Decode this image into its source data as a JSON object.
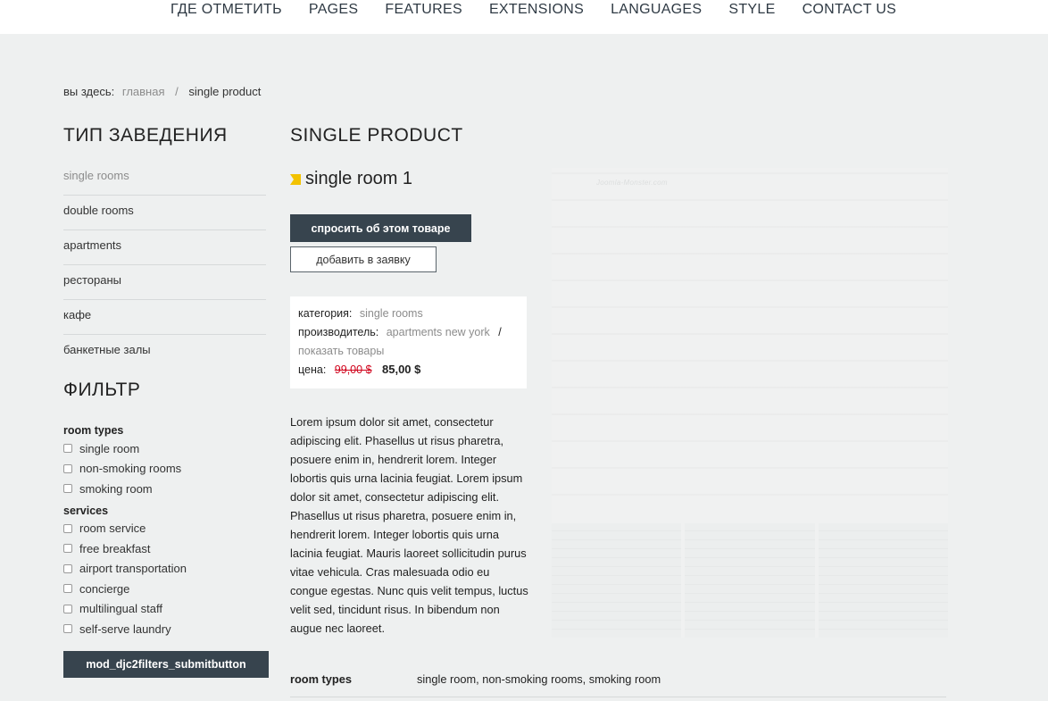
{
  "nav": {
    "items": [
      "ГДЕ ОТМЕТИТЬ",
      "PAGES",
      "FEATURES",
      "EXTENSIONS",
      "LANGUAGES",
      "STYLE",
      "CONTACT US"
    ]
  },
  "breadcrumb": {
    "label": "вы здесь:",
    "home": "главная",
    "separator": "/",
    "current": "single product"
  },
  "sidebar": {
    "category_title": "ТИП ЗАВЕДЕНИЯ",
    "items": [
      {
        "label": "single rooms",
        "active": true
      },
      {
        "label": "double rooms",
        "active": false
      },
      {
        "label": "apartments",
        "active": false
      },
      {
        "label": "рестораны",
        "active": false
      },
      {
        "label": "кафе",
        "active": false
      },
      {
        "label": "банкетные залы",
        "active": false
      }
    ],
    "filter_title": "ФИЛЬТР",
    "filter_groups": [
      {
        "title": "room types",
        "options": [
          "single room",
          "non-smoking rooms",
          "smoking room"
        ]
      },
      {
        "title": "services",
        "options": [
          "room service",
          "free breakfast",
          "airport transportation",
          "concierge",
          "multilingual staff",
          "self-serve laundry"
        ]
      }
    ],
    "submit_label": "mod_djc2filters_submitbutton"
  },
  "main": {
    "title": "SINGLE PRODUCT",
    "product_name": "single room 1",
    "ask_button": "спросить об этом товаре",
    "add_button": "добавить в заявку",
    "info": {
      "category_label": "категория:",
      "category_value": "single rooms",
      "producer_label": "производитель:",
      "producer_value": "apartments new york",
      "producer_sep": "/",
      "show_products": "показать товары",
      "price_label": "цена:",
      "old_price": "99,00 $",
      "new_price": "85,00 $"
    },
    "description": "Lorem ipsum dolor sit amet, consectetur adipiscing elit. Phasellus ut risus pharetra, posuere enim in, hendrerit lorem. Integer lobortis quis urna lacinia feugiat. Lorem ipsum dolor sit amet, consectetur adipiscing elit. Phasellus ut risus pharetra, posuere enim in, hendrerit lorem. Integer lobortis quis urna lacinia feugiat. Mauris laoreet sollicitudin purus vitae vehicula. Cras malesuada odio eu congue egestas. Nunc quis velit tempus, luctus velit sed, tincidunt risus. In bibendum non augue nec laoreet.",
    "watermark": "Joomla-Monster.com",
    "attributes": [
      {
        "name": "room types",
        "value": "single room, non-smoking rooms, smoking room"
      }
    ]
  },
  "colors": {
    "dark_button": "#37444e",
    "accent_flag": "#f2c200",
    "old_price": "#d0021b"
  }
}
